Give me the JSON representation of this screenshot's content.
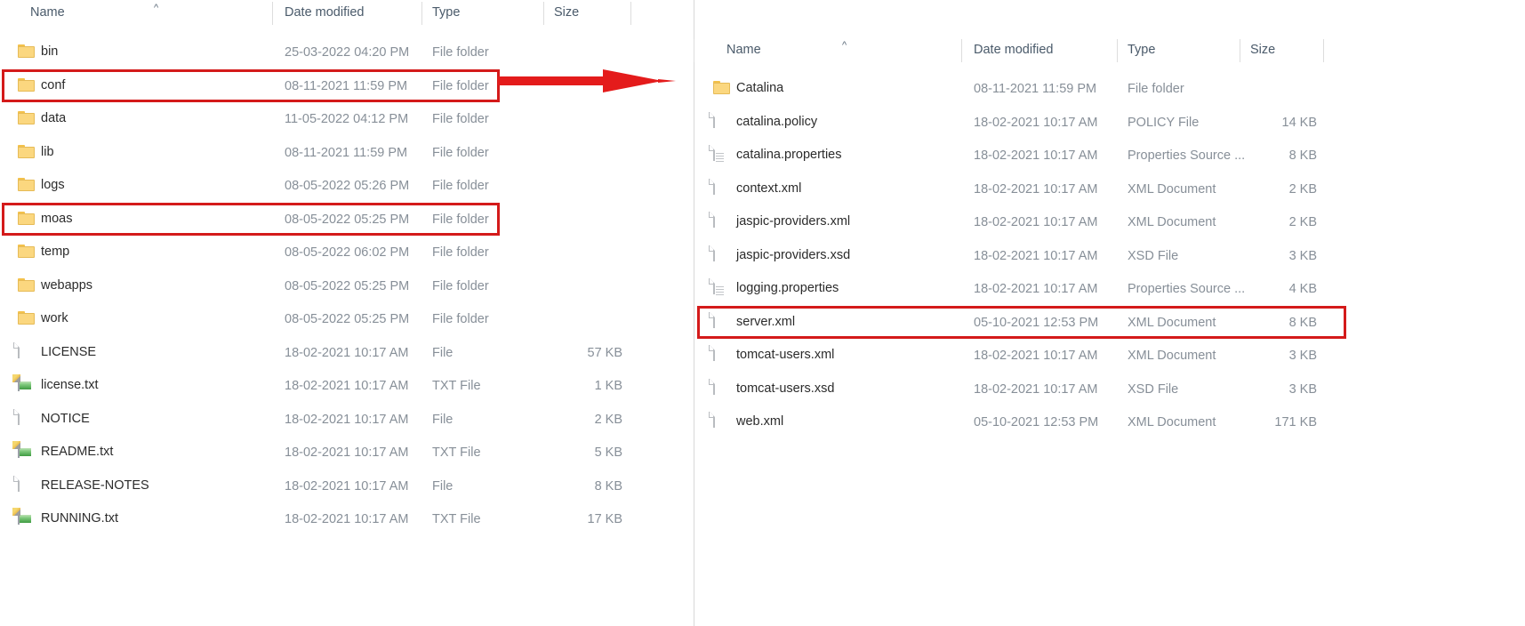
{
  "left_panel": {
    "columns": {
      "name": "Name",
      "date_modified": "Date modified",
      "type": "Type",
      "size": "Size"
    },
    "sort_indicator": "^",
    "rows": [
      {
        "icon": "folder-icon",
        "name": "bin",
        "date": "25-03-2022 04:20 PM",
        "type": "File folder",
        "size": "",
        "highlighted": false
      },
      {
        "icon": "folder-icon",
        "name": "conf",
        "date": "08-11-2021 11:59 PM",
        "type": "File folder",
        "size": "",
        "highlighted": true
      },
      {
        "icon": "folder-icon",
        "name": "data",
        "date": "11-05-2022 04:12 PM",
        "type": "File folder",
        "size": "",
        "highlighted": false
      },
      {
        "icon": "folder-icon",
        "name": "lib",
        "date": "08-11-2021 11:59 PM",
        "type": "File folder",
        "size": "",
        "highlighted": false
      },
      {
        "icon": "folder-icon",
        "name": "logs",
        "date": "08-05-2022 05:26 PM",
        "type": "File folder",
        "size": "",
        "highlighted": false
      },
      {
        "icon": "folder-icon",
        "name": "moas",
        "date": "08-05-2022 05:25 PM",
        "type": "File folder",
        "size": "",
        "highlighted": true
      },
      {
        "icon": "folder-icon",
        "name": "temp",
        "date": "08-05-2022 06:02 PM",
        "type": "File folder",
        "size": "",
        "highlighted": false
      },
      {
        "icon": "folder-icon",
        "name": "webapps",
        "date": "08-05-2022 05:25 PM",
        "type": "File folder",
        "size": "",
        "highlighted": false
      },
      {
        "icon": "folder-icon",
        "name": "work",
        "date": "08-05-2022 05:25 PM",
        "type": "File folder",
        "size": "",
        "highlighted": false
      },
      {
        "icon": "file-icon",
        "name": "LICENSE",
        "date": "18-02-2021 10:17 AM",
        "type": "File",
        "size": "57 KB",
        "highlighted": false
      },
      {
        "icon": "txt-file-icon",
        "name": "license.txt",
        "date": "18-02-2021 10:17 AM",
        "type": "TXT File",
        "size": "1 KB",
        "highlighted": false
      },
      {
        "icon": "file-icon",
        "name": "NOTICE",
        "date": "18-02-2021 10:17 AM",
        "type": "File",
        "size": "2 KB",
        "highlighted": false
      },
      {
        "icon": "txt-file-icon",
        "name": "README.txt",
        "date": "18-02-2021 10:17 AM",
        "type": "TXT File",
        "size": "5 KB",
        "highlighted": false
      },
      {
        "icon": "file-icon",
        "name": "RELEASE-NOTES",
        "date": "18-02-2021 10:17 AM",
        "type": "File",
        "size": "8 KB",
        "highlighted": false
      },
      {
        "icon": "txt-file-icon",
        "name": "RUNNING.txt",
        "date": "18-02-2021 10:17 AM",
        "type": "TXT File",
        "size": "17 KB",
        "highlighted": false
      }
    ]
  },
  "right_panel": {
    "columns": {
      "name": "Name",
      "date_modified": "Date modified",
      "type": "Type",
      "size": "Size"
    },
    "sort_indicator": "^",
    "rows": [
      {
        "icon": "folder-icon",
        "name": "Catalina",
        "date": "08-11-2021 11:59 PM",
        "type": "File folder",
        "size": "",
        "highlighted": false
      },
      {
        "icon": "file-icon",
        "name": "catalina.policy",
        "date": "18-02-2021 10:17 AM",
        "type": "POLICY File",
        "size": "14 KB",
        "highlighted": false
      },
      {
        "icon": "props-icon",
        "name": "catalina.properties",
        "date": "18-02-2021 10:17 AM",
        "type": "Properties Source ...",
        "size": "8 KB",
        "highlighted": false
      },
      {
        "icon": "file-icon",
        "name": "context.xml",
        "date": "18-02-2021 10:17 AM",
        "type": "XML Document",
        "size": "2 KB",
        "highlighted": false
      },
      {
        "icon": "file-icon",
        "name": "jaspic-providers.xml",
        "date": "18-02-2021 10:17 AM",
        "type": "XML Document",
        "size": "2 KB",
        "highlighted": false
      },
      {
        "icon": "file-icon",
        "name": "jaspic-providers.xsd",
        "date": "18-02-2021 10:17 AM",
        "type": "XSD File",
        "size": "3 KB",
        "highlighted": false
      },
      {
        "icon": "props-icon",
        "name": "logging.properties",
        "date": "18-02-2021 10:17 AM",
        "type": "Properties Source ...",
        "size": "4 KB",
        "highlighted": false
      },
      {
        "icon": "file-icon",
        "name": "server.xml",
        "date": "05-10-2021 12:53 PM",
        "type": "XML Document",
        "size": "8 KB",
        "highlighted": true
      },
      {
        "icon": "file-icon",
        "name": "tomcat-users.xml",
        "date": "18-02-2021 10:17 AM",
        "type": "XML Document",
        "size": "3 KB",
        "highlighted": false
      },
      {
        "icon": "file-icon",
        "name": "tomcat-users.xsd",
        "date": "18-02-2021 10:17 AM",
        "type": "XSD File",
        "size": "3 KB",
        "highlighted": false
      },
      {
        "icon": "file-icon",
        "name": "web.xml",
        "date": "05-10-2021 12:53 PM",
        "type": "XML Document",
        "size": "171 KB",
        "highlighted": false
      }
    ]
  },
  "annotations": {
    "arrow": {
      "name": "red-arrow",
      "color": "#e41b1b",
      "direction": "right"
    },
    "highlight_color": "#d41a1a"
  }
}
